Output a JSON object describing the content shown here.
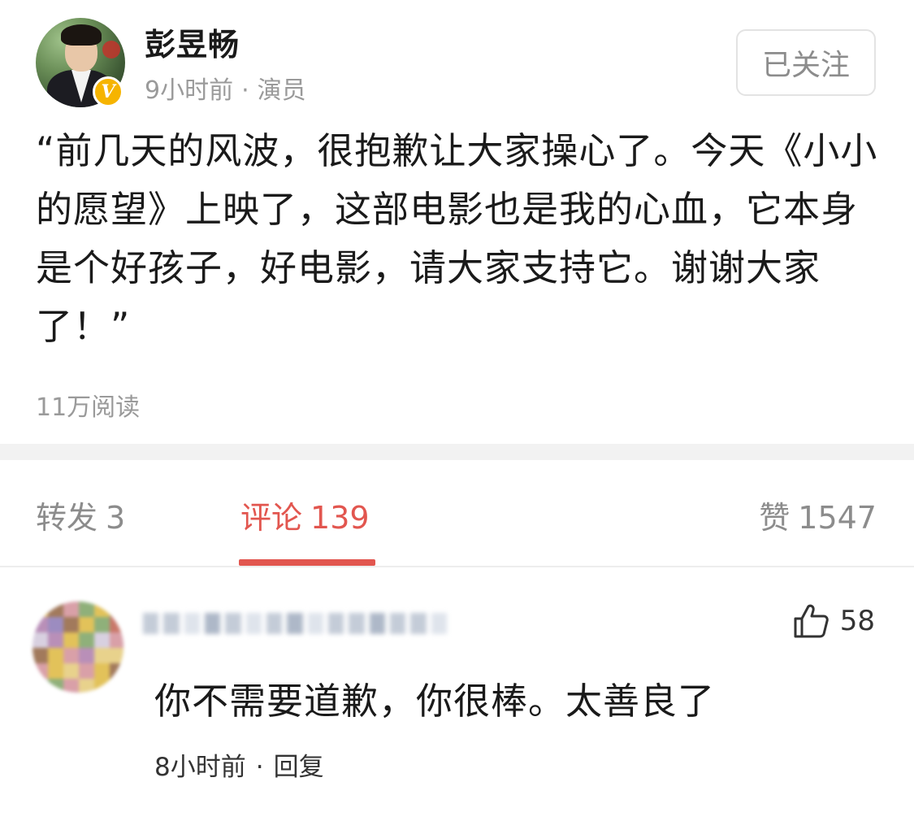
{
  "post": {
    "author_name": "彭昱畅",
    "time": "9小时前",
    "separator": "·",
    "author_tag": "演员",
    "follow_label": "已关注",
    "text": "“前几天的风波，很抱歉让大家操心了。今天《小小的愿望》上映了，这部电影也是我的心血，它本身是个好孩子，好电影，请大家支持它。谢谢大家了！”",
    "read_count": "11万阅读",
    "verified_mark": "V"
  },
  "tabs": [
    {
      "label": "转发",
      "count": "3",
      "active": false
    },
    {
      "label": "评论",
      "count": "139",
      "active": true
    },
    {
      "label": "赞",
      "count": "1547",
      "active": false
    }
  ],
  "comment": {
    "like_count": "58",
    "text": "你不需要道歉，你很棒。太善良了",
    "time": "8小时前",
    "separator": "·",
    "reply_label": "回复"
  },
  "colors": {
    "accent": "#e2564f",
    "muted_text": "#9a9a9a",
    "verified": "#f6b400"
  },
  "icons": {
    "verified": "verified-badge-icon",
    "like": "thumbs-up-icon"
  }
}
